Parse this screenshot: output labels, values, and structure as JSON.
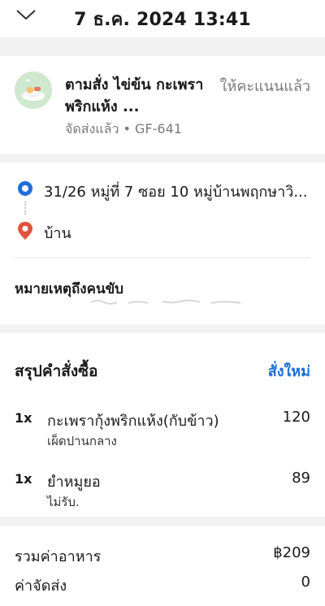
{
  "header": {
    "title": "7 ธ.ค. 2024 13:41"
  },
  "restaurant": {
    "name": "ตามสั่ง ไข่ข้น กะเพราพริกแห้ง ...",
    "status": "จัดส่งแล้ว • GF-641",
    "rate_label": "ให้คะแนนแล้ว"
  },
  "delivery": {
    "address": "31/26 หมู่ที่ 7 ซอย 10 หมู่บ้านพฤกษาวิ...",
    "destination_label": "บ้าน",
    "note_title": "หมายเหตุถึงคนขับ"
  },
  "summary": {
    "title": "สรุปคำสั่งซื้อ",
    "reorder_label": "สั่งใหม่",
    "items": [
      {
        "qty": "1x",
        "name": "กะเพรากุ้งพริกแห้ง(กับข้าว)",
        "note": "เผ็ดปานกลาง",
        "price": "120"
      },
      {
        "qty": "1x",
        "name": "ยำหมูยอ",
        "note": "ไม่รับ.",
        "price": "89"
      }
    ]
  },
  "totals": {
    "food_label": "รวมค่าอาหาร",
    "food_value": "฿209",
    "delivery_label": "ค่าจัดส่ง",
    "delivery_value": "0"
  },
  "colors": {
    "accent": "#1e6fd9",
    "pin_red": "#e0533f",
    "muted": "#7a7a7a"
  }
}
